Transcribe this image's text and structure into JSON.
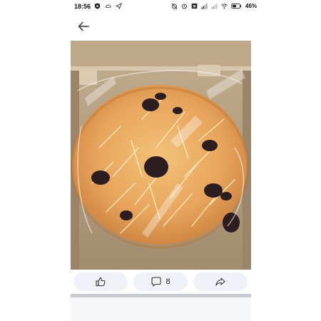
{
  "status_bar": {
    "time": "18:56",
    "battery_text": "46%",
    "left_icons": [
      "shield-icon",
      "cloud-icon",
      "send-icon"
    ],
    "right_icons": [
      "alarm-off-icon",
      "alarm-icon",
      "nfc-icon",
      "signal-icon",
      "signal-icon",
      "wifi-icon",
      "battery-icon"
    ]
  },
  "header": {
    "back_icon": "arrow-left-icon"
  },
  "post": {
    "image_subject": "bread-photo"
  },
  "actions": {
    "like_icon": "thumbs-up-icon",
    "comment_icon": "comment-icon",
    "comment_count": "8",
    "share_icon": "share-icon"
  },
  "colors": {
    "action_bg": "#eef1f6",
    "divider": "#c8ccd2"
  }
}
